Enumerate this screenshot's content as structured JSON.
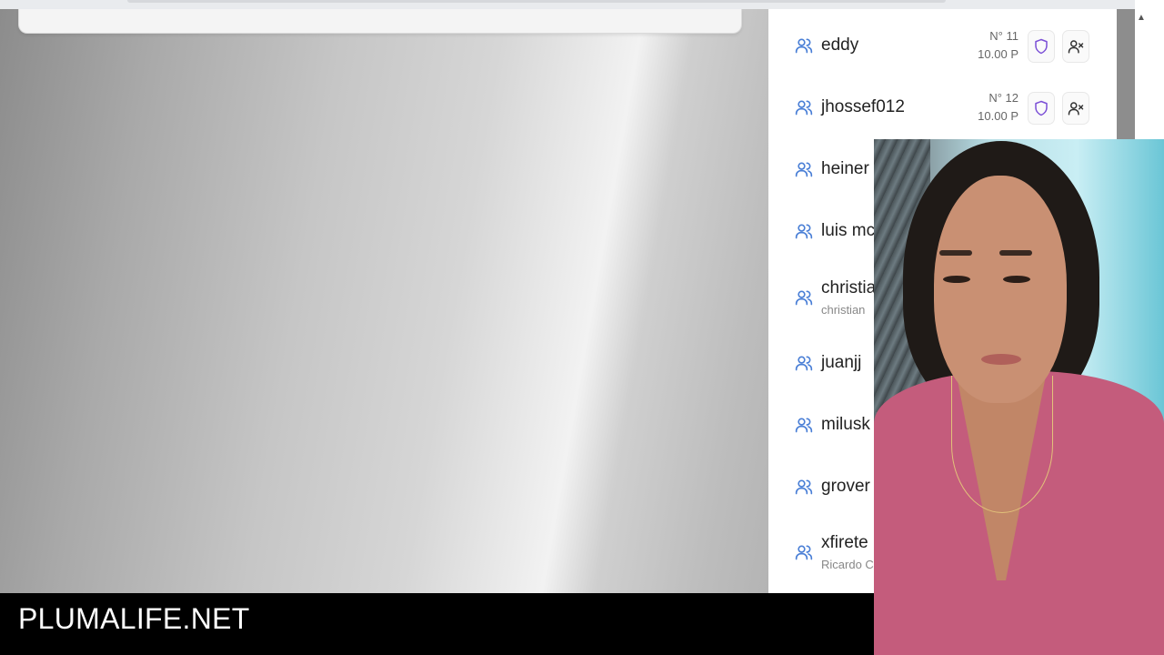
{
  "users": [
    {
      "name": "eddy",
      "number": "N° 11",
      "amount": "10.00 P",
      "show_actions": true
    },
    {
      "name": "jhossef012",
      "number": "N° 12",
      "amount": "10.00 P",
      "show_actions": true
    },
    {
      "name": "heiner",
      "number": "",
      "amount": "",
      "show_actions": false
    },
    {
      "name": "luis mc",
      "number": "",
      "amount": "",
      "show_actions": false
    },
    {
      "name": "christia",
      "sub": "christian",
      "show_actions": false
    },
    {
      "name": "juanjj",
      "show_actions": false
    },
    {
      "name": "milusk",
      "show_actions": false
    },
    {
      "name": "grover",
      "show_actions": false
    },
    {
      "name": "xfirete",
      "sub": "Ricardo C",
      "show_actions": false
    }
  ],
  "brand": {
    "text": "PLUMALIFE.NET"
  },
  "colors": {
    "user_icon": "#4a7fd6",
    "shield_icon": "#7b4fd6",
    "brand_bg": "#000000",
    "brand_text": "#ffffff"
  },
  "icons": {
    "row": "users-icon",
    "shield": "shield-icon",
    "remove": "remove-user-icon"
  }
}
